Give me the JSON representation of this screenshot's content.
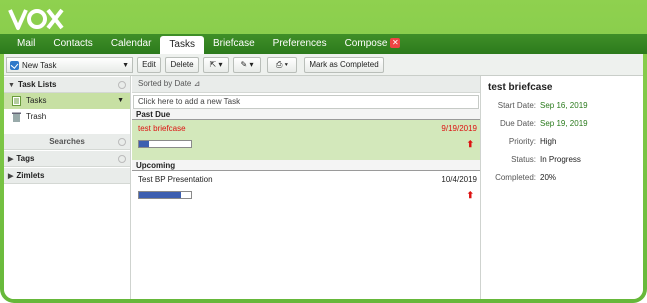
{
  "brand": {
    "logo_text": "VOX"
  },
  "nav": {
    "tabs": [
      {
        "label": "Mail",
        "active": false
      },
      {
        "label": "Contacts",
        "active": false
      },
      {
        "label": "Calendar",
        "active": false
      },
      {
        "label": "Tasks",
        "active": true
      },
      {
        "label": "Briefcase",
        "active": false
      },
      {
        "label": "Preferences",
        "active": false
      },
      {
        "label": "Compose",
        "active": false
      }
    ]
  },
  "toolbar": {
    "new_task": "New Task",
    "edit": "Edit",
    "delete": "Delete",
    "mark_completed": "Mark as Completed"
  },
  "sidebar": {
    "task_lists_header": "Task Lists",
    "items": [
      {
        "label": "Tasks",
        "selected": true
      },
      {
        "label": "Trash",
        "selected": false
      }
    ],
    "searches_header": "Searches",
    "tags_header": "Tags",
    "zimlets_header": "Zimlets"
  },
  "list": {
    "sort_label": "Sorted by Date",
    "add_placeholder": "Click here to add a new Task",
    "groups": [
      {
        "label": "Past Due",
        "tasks": [
          {
            "name": "test briefcase",
            "date": "9/19/2019",
            "progress_percent": 20,
            "priority": "High",
            "overdue": true,
            "selected": true
          }
        ]
      },
      {
        "label": "Upcoming",
        "tasks": [
          {
            "name": "Test BP Presentation",
            "date": "10/4/2019",
            "progress_percent": 80,
            "priority": "High",
            "overdue": false,
            "selected": false
          }
        ]
      }
    ]
  },
  "detail": {
    "title": "test briefcase",
    "start_label": "Start Date:",
    "start_value": "Sep 16, 2019",
    "due_label": "Due Date:",
    "due_value": "Sep 19, 2019",
    "priority_label": "Priority:",
    "priority_value": "High",
    "status_label": "Status:",
    "status_value": "In Progress",
    "completed_label": "Completed:",
    "completed_value": "20%"
  },
  "colors": {
    "brand_green": "#66b83a",
    "nav_green": "#2c7a1c",
    "selection_green": "#c7e0a3",
    "overdue_red": "#dd1111",
    "progress_blue": "#3d5fb0"
  }
}
